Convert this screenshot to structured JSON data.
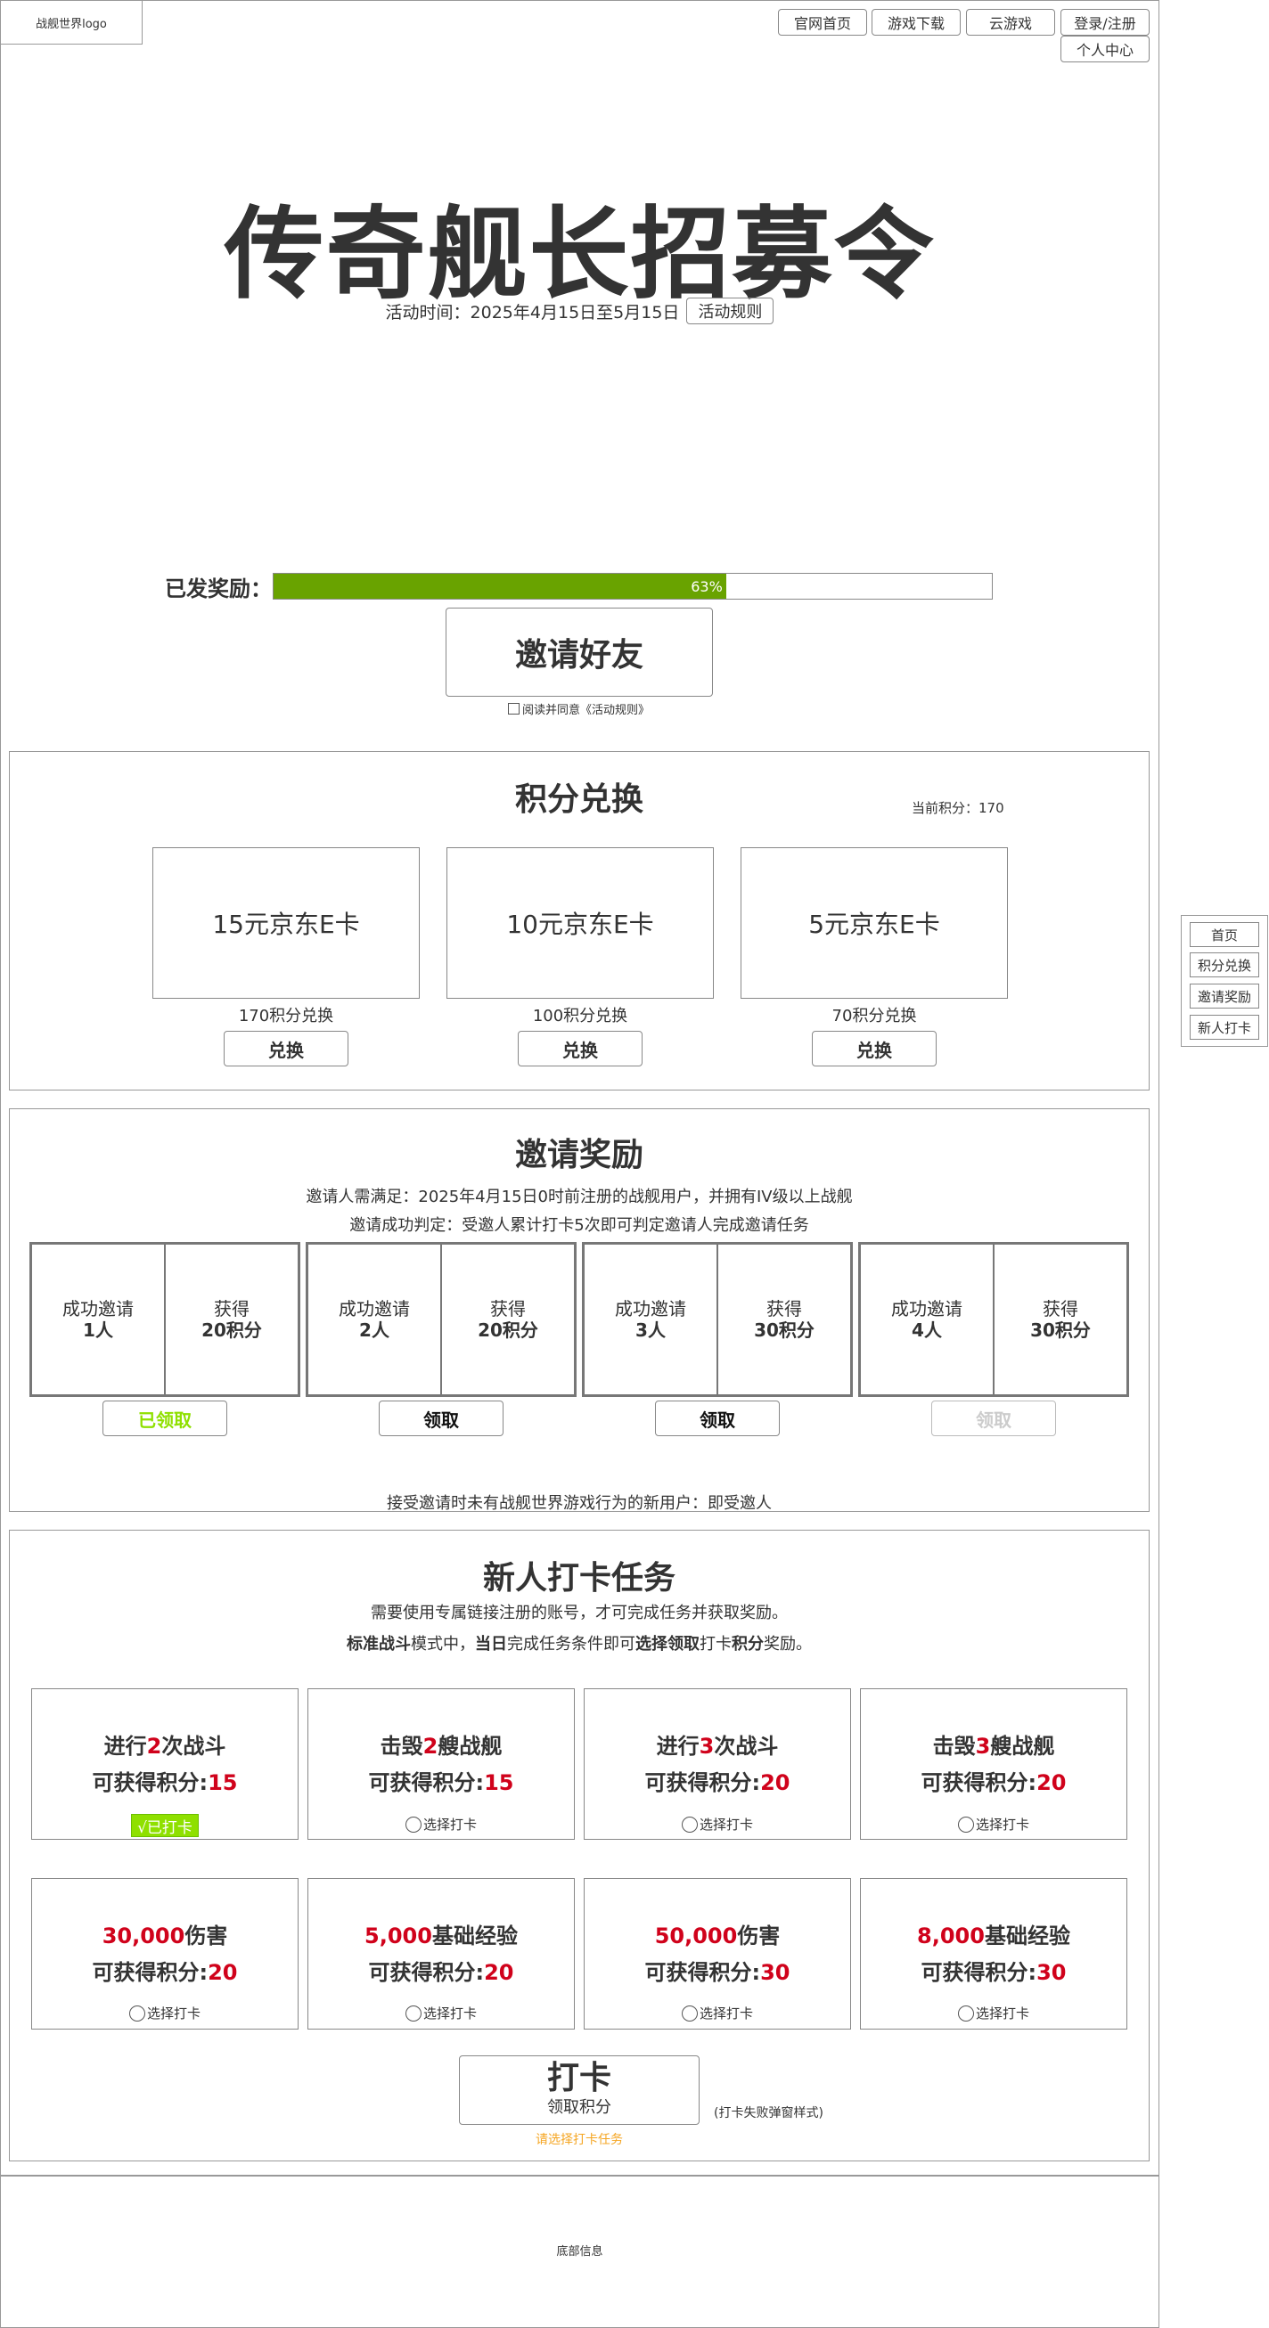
{
  "header": {
    "logo": "战舰世界logo",
    "nav": [
      "官网首页",
      "游戏下载",
      "云游戏",
      "登录/注册"
    ],
    "user_center": "个人中心"
  },
  "hero": {
    "title": "传奇舰长招募令",
    "time_text": "活动时间：2025年4月15日至5月15日",
    "rules_button": "活动规则",
    "issued_label": "已发奖励：",
    "progress_percent": 63,
    "progress_text": "63%",
    "invite_button": "邀请好友",
    "agree_text": "阅读并同意《活动规则》"
  },
  "exchange": {
    "title": "积分兑换",
    "current_points": "当前积分：170",
    "items": [
      {
        "name": "15元京东E卡",
        "cost": "170积分兑换",
        "button": "兑换"
      },
      {
        "name": "10元京东E卡",
        "cost": "100积分兑换",
        "button": "兑换"
      },
      {
        "name": "5元京东E卡",
        "cost": "70积分兑换",
        "button": "兑换"
      }
    ]
  },
  "invite": {
    "title": "邀请奖励",
    "desc1": "邀请人需满足：2025年4月15日0时前注册的战舰用户，并拥有IV级以上战舰",
    "desc2": "邀请成功判定：受邀人累计打卡5次即可判定邀请人完成邀请任务",
    "tiers": [
      {
        "label": "成功邀请",
        "count": "1人",
        "reward_label": "获得",
        "reward": "20积分",
        "button": "已领取",
        "state": "claimed"
      },
      {
        "label": "成功邀请",
        "count": "2人",
        "reward_label": "获得",
        "reward": "20积分",
        "button": "领取",
        "state": "available"
      },
      {
        "label": "成功邀请",
        "count": "3人",
        "reward_label": "获得",
        "reward": "30积分",
        "button": "领取",
        "state": "available"
      },
      {
        "label": "成功邀请",
        "count": "4人",
        "reward_label": "获得",
        "reward": "30积分",
        "button": "领取",
        "state": "disabled"
      }
    ],
    "footer_note": "接受邀请时未有战舰世界游戏行为的新用户：即受邀人"
  },
  "checkin": {
    "title": "新人打卡任务",
    "desc1": "需要使用专属链接注册的账号，才可完成任务并获取奖励。",
    "desc2_parts": [
      "标准战斗",
      "模式中，",
      "当日",
      "完成任务条件即可",
      "选择领取",
      "打卡",
      "积分",
      "奖励。"
    ],
    "points_label": "可获得积分:",
    "select_label": "选择打卡",
    "checked_label": "√已打卡",
    "tasks": [
      {
        "pre": "进行",
        "num": "2",
        "post": "次战斗",
        "points": "15",
        "checked": true
      },
      {
        "pre": "击毁",
        "num": "2",
        "post": "艘战舰",
        "points": "15",
        "checked": false
      },
      {
        "pre": "进行",
        "num": "3",
        "post": "次战斗",
        "points": "20",
        "checked": false
      },
      {
        "pre": "击毁",
        "num": "3",
        "post": "艘战舰",
        "points": "20",
        "checked": false
      },
      {
        "pre": "",
        "num": "30,000",
        "post": "伤害",
        "points": "20",
        "checked": false
      },
      {
        "pre": "",
        "num": "5,000",
        "post": "基础经验",
        "points": "20",
        "checked": false
      },
      {
        "pre": "",
        "num": "50,000",
        "post": "伤害",
        "points": "30",
        "checked": false
      },
      {
        "pre": "",
        "num": "8,000",
        "post": "基础经验",
        "points": "30",
        "checked": false
      }
    ],
    "checkin_button_main": "打卡",
    "checkin_button_sub": "领取积分",
    "fail_note": "(打卡失败弹窗样式)",
    "hint": "请选择打卡任务"
  },
  "footer": {
    "text": "底部信息"
  },
  "side_nav": [
    "首页",
    "积分兑换",
    "邀请奖励",
    "新人打卡"
  ],
  "colors": {
    "progress": "#69a300",
    "highlight_red": "#d0021b",
    "claimed_green": "#8fe000",
    "hint_orange": "#f5a623"
  }
}
